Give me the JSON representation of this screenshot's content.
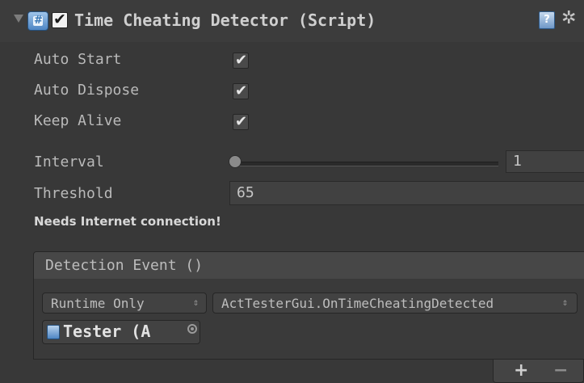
{
  "component": {
    "title": "Time Cheating Detector (Script)",
    "enabled": true,
    "help_icon_glyph": "?",
    "gear_icon_glyph": "✲"
  },
  "fields": {
    "auto_start": {
      "label": "Auto Start",
      "checked": true
    },
    "auto_dispose": {
      "label": "Auto Dispose",
      "checked": true
    },
    "keep_alive": {
      "label": "Keep Alive",
      "checked": true
    },
    "interval": {
      "label": "Interval",
      "value": "1"
    },
    "threshold": {
      "label": "Threshold",
      "value": "65"
    }
  },
  "warning": "Needs Internet connection!",
  "event": {
    "title": "Detection Event ()",
    "call_state": "Runtime Only",
    "function": "ActTesterGui.OnTimeCheatingDetected",
    "target_object": "Tester (A",
    "add_label": "+",
    "remove_label": "−"
  },
  "glyphs": {
    "check": "✔",
    "updown": "⇕"
  }
}
